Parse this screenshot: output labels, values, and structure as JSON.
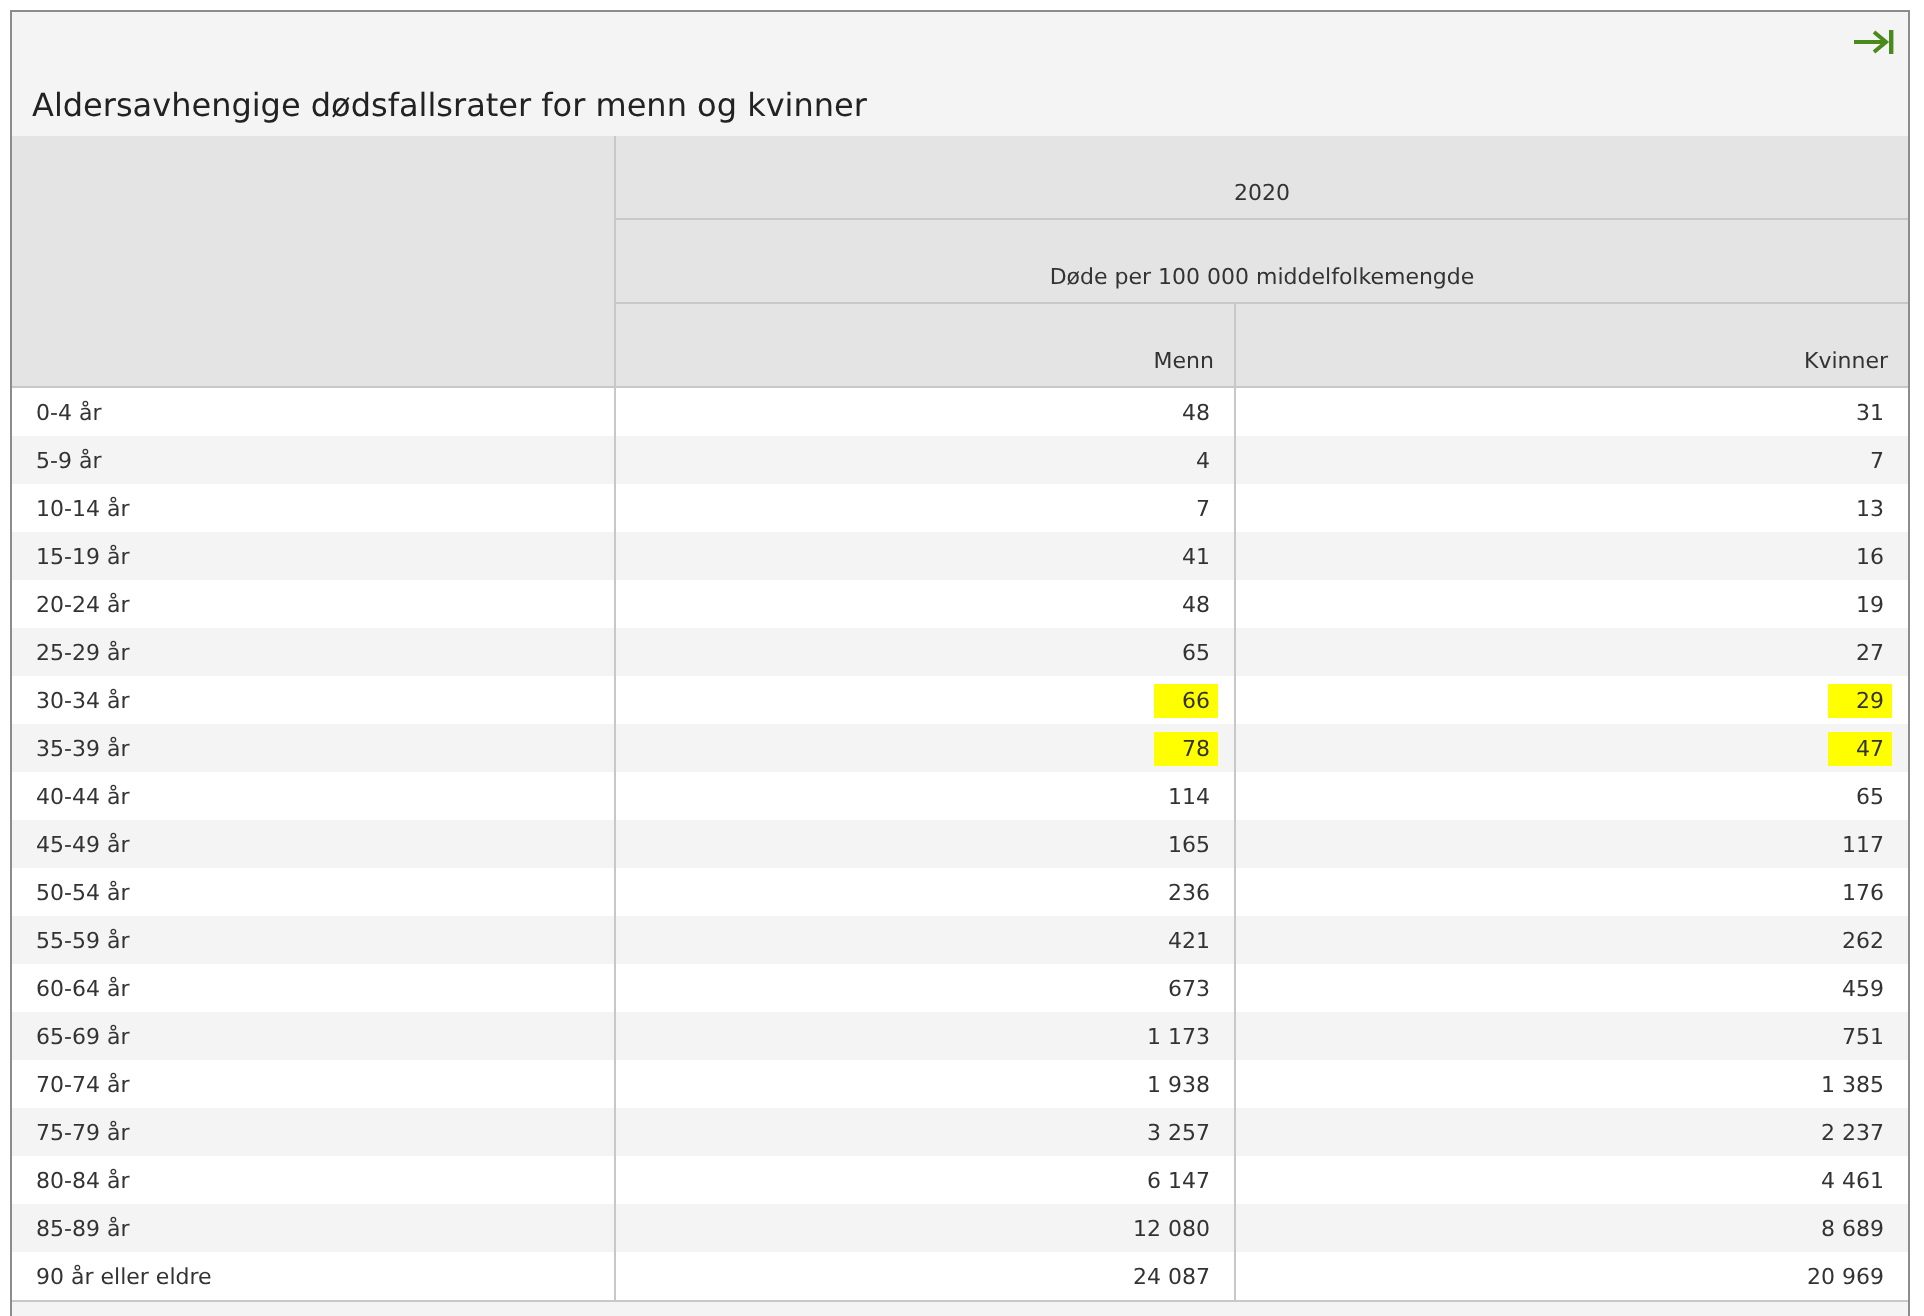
{
  "title": "Aldersavhengige dødsfallsrater for menn og kvinner",
  "table": {
    "header_year": "2020",
    "header_measure": "Døde per 100 000 middelfolkemengde",
    "columns": [
      "Menn",
      "Kvinner"
    ],
    "rows": [
      {
        "label": "0-4 år",
        "cells": [
          {
            "value": "48",
            "highlighted": false
          },
          {
            "value": "31",
            "highlighted": false
          }
        ]
      },
      {
        "label": "5-9 år",
        "cells": [
          {
            "value": "4",
            "highlighted": false
          },
          {
            "value": "7",
            "highlighted": false
          }
        ]
      },
      {
        "label": "10-14 år",
        "cells": [
          {
            "value": "7",
            "highlighted": false
          },
          {
            "value": "13",
            "highlighted": false
          }
        ]
      },
      {
        "label": "15-19 år",
        "cells": [
          {
            "value": "41",
            "highlighted": false
          },
          {
            "value": "16",
            "highlighted": false
          }
        ]
      },
      {
        "label": "20-24 år",
        "cells": [
          {
            "value": "48",
            "highlighted": false
          },
          {
            "value": "19",
            "highlighted": false
          }
        ]
      },
      {
        "label": "25-29 år",
        "cells": [
          {
            "value": "65",
            "highlighted": false
          },
          {
            "value": "27",
            "highlighted": false
          }
        ]
      },
      {
        "label": "30-34 år",
        "cells": [
          {
            "value": "66",
            "highlighted": true
          },
          {
            "value": "29",
            "highlighted": true
          }
        ]
      },
      {
        "label": "35-39 år",
        "cells": [
          {
            "value": "78",
            "highlighted": true
          },
          {
            "value": "47",
            "highlighted": true
          }
        ]
      },
      {
        "label": "40-44 år",
        "cells": [
          {
            "value": "114",
            "highlighted": false
          },
          {
            "value": "65",
            "highlighted": false
          }
        ]
      },
      {
        "label": "45-49 år",
        "cells": [
          {
            "value": "165",
            "highlighted": false
          },
          {
            "value": "117",
            "highlighted": false
          }
        ]
      },
      {
        "label": "50-54 år",
        "cells": [
          {
            "value": "236",
            "highlighted": false
          },
          {
            "value": "176",
            "highlighted": false
          }
        ]
      },
      {
        "label": "55-59 år",
        "cells": [
          {
            "value": "421",
            "highlighted": false
          },
          {
            "value": "262",
            "highlighted": false
          }
        ]
      },
      {
        "label": "60-64 år",
        "cells": [
          {
            "value": "673",
            "highlighted": false
          },
          {
            "value": "459",
            "highlighted": false
          }
        ]
      },
      {
        "label": "65-69 år",
        "cells": [
          {
            "value": "1 173",
            "highlighted": false
          },
          {
            "value": "751",
            "highlighted": false
          }
        ]
      },
      {
        "label": "70-74 år",
        "cells": [
          {
            "value": "1 938",
            "highlighted": false
          },
          {
            "value": "1 385",
            "highlighted": false
          }
        ]
      },
      {
        "label": "75-79 år",
        "cells": [
          {
            "value": "3 257",
            "highlighted": false
          },
          {
            "value": "2 237",
            "highlighted": false
          }
        ]
      },
      {
        "label": "80-84 år",
        "cells": [
          {
            "value": "6 147",
            "highlighted": false
          },
          {
            "value": "4 461",
            "highlighted": false
          }
        ]
      },
      {
        "label": "85-89 år",
        "cells": [
          {
            "value": "12 080",
            "highlighted": false
          },
          {
            "value": "8 689",
            "highlighted": false
          }
        ]
      },
      {
        "label": "90 år eller eldre",
        "cells": [
          {
            "value": "24 087",
            "highlighted": false
          },
          {
            "value": "20 969",
            "highlighted": false
          }
        ]
      }
    ]
  }
}
